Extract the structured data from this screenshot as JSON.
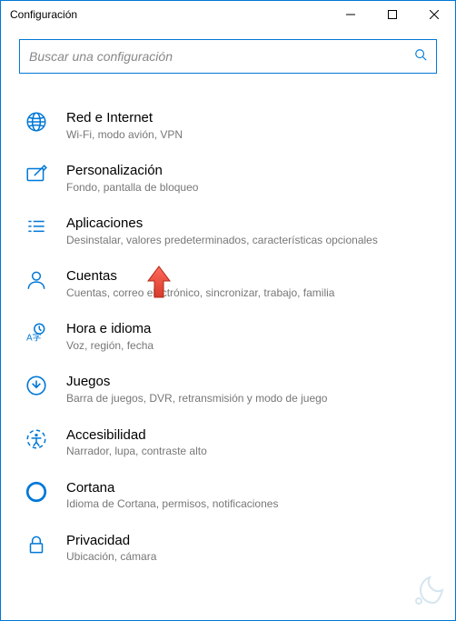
{
  "window": {
    "title": "Configuración"
  },
  "search": {
    "placeholder": "Buscar una configuración"
  },
  "items": [
    {
      "title": "Red e Internet",
      "desc": "Wi-Fi, modo avión, VPN"
    },
    {
      "title": "Personalización",
      "desc": "Fondo, pantalla de bloqueo"
    },
    {
      "title": "Aplicaciones",
      "desc": "Desinstalar, valores predeterminados, características opcionales"
    },
    {
      "title": "Cuentas",
      "desc": "Cuentas, correo electrónico, sincronizar, trabajo, familia"
    },
    {
      "title": "Hora e idioma",
      "desc": "Voz, región, fecha"
    },
    {
      "title": "Juegos",
      "desc": "Barra de juegos, DVR, retransmisión y modo de juego"
    },
    {
      "title": "Accesibilidad",
      "desc": "Narrador, lupa, contraste alto"
    },
    {
      "title": "Cortana",
      "desc": "Idioma de Cortana, permisos, notificaciones"
    },
    {
      "title": "Privacidad",
      "desc": "Ubicación, cámara"
    }
  ]
}
